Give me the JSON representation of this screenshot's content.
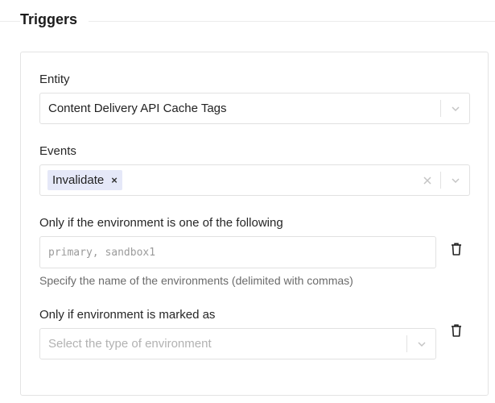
{
  "section": {
    "title": "Triggers"
  },
  "entity": {
    "label": "Entity",
    "value": "Content Delivery API Cache Tags"
  },
  "events": {
    "label": "Events",
    "chips": [
      {
        "label": "Invalidate",
        "remove": "×"
      }
    ]
  },
  "env_filter": {
    "label": "Only if the environment is one of the following",
    "placeholder": "primary, sandbox1",
    "hint": "Specify the name of the environments (delimited with commas)"
  },
  "env_type": {
    "label": "Only if environment is marked as",
    "placeholder": "Select the type of environment"
  },
  "icons": {
    "chevron": "chevron-down-icon",
    "clear": "close-icon",
    "delete": "trash-icon"
  },
  "colors": {
    "chip_bg": "#e5e8f8",
    "border": "#e1e1e1",
    "muted_text": "#6b6b6b",
    "placeholder_text": "#b2b2b2"
  }
}
